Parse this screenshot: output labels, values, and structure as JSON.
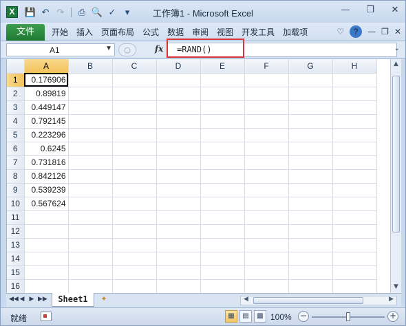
{
  "window": {
    "title": "工作簿1 - Microsoft Excel",
    "app_icon": "X"
  },
  "quick_access": {
    "icons": [
      "save-icon",
      "undo-icon",
      "redo-icon",
      "print-icon",
      "print-preview-icon",
      "spelling-icon",
      "customize-icon"
    ]
  },
  "ribbon": {
    "file_tab": "文件",
    "tabs": [
      "开始",
      "插入",
      "页面布局",
      "公式",
      "数据",
      "审阅",
      "视图",
      "开发工具",
      "加载项"
    ],
    "help": "?"
  },
  "formula_bar": {
    "name_box": "A1",
    "fx_label": "fx",
    "formula": "=RAND()"
  },
  "sheet": {
    "columns": [
      "A",
      "B",
      "C",
      "D",
      "E",
      "F",
      "G",
      "H"
    ],
    "selected_column": "A",
    "rows": [
      {
        "num": "1",
        "a": "0.176906"
      },
      {
        "num": "2",
        "a": "0.89819"
      },
      {
        "num": "3",
        "a": "0.449147"
      },
      {
        "num": "4",
        "a": "0.792145"
      },
      {
        "num": "5",
        "a": "0.223296"
      },
      {
        "num": "6",
        "a": "0.6245"
      },
      {
        "num": "7",
        "a": "0.731816"
      },
      {
        "num": "8",
        "a": "0.842126"
      },
      {
        "num": "9",
        "a": "0.539239"
      },
      {
        "num": "10",
        "a": "0.567624"
      },
      {
        "num": "11",
        "a": ""
      },
      {
        "num": "12",
        "a": ""
      },
      {
        "num": "13",
        "a": ""
      },
      {
        "num": "14",
        "a": ""
      },
      {
        "num": "15",
        "a": ""
      },
      {
        "num": "16",
        "a": ""
      }
    ],
    "active_cell": "A1"
  },
  "sheet_tabs": {
    "active": "Sheet1"
  },
  "status_bar": {
    "status": "就绪",
    "zoom": "100%"
  }
}
